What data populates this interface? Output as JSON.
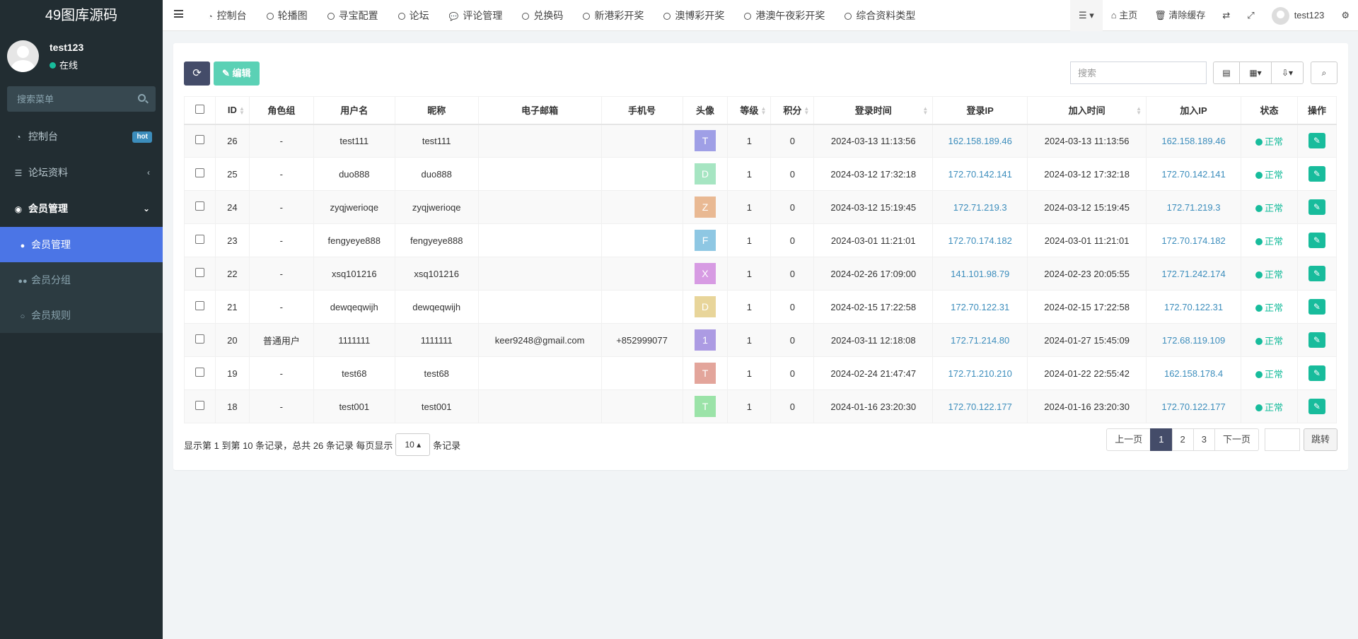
{
  "brand": "49图库源码",
  "user": {
    "name": "test123",
    "status": "在线"
  },
  "sidebar": {
    "search_placeholder": "搜索菜单",
    "items": [
      {
        "label": "控制台",
        "badge": "hot"
      },
      {
        "label": "论坛资料"
      },
      {
        "label": "会员管理"
      }
    ],
    "sub": [
      {
        "label": "会员管理"
      },
      {
        "label": "会员分组"
      },
      {
        "label": "会员规则"
      }
    ]
  },
  "tabs": [
    "控制台",
    "轮播图",
    "寻宝配置",
    "论坛",
    "评论管理",
    "兑换码",
    "新港彩开奖",
    "澳博彩开奖",
    "港澳午夜彩开奖",
    "综合资料类型"
  ],
  "topright": {
    "home": "主页",
    "clear": "清除缓存",
    "user": "test123"
  },
  "toolbar": {
    "edit": "编辑",
    "search_placeholder": "搜索"
  },
  "columns": [
    "ID",
    "角色组",
    "用户名",
    "昵称",
    "电子邮箱",
    "手机号",
    "头像",
    "等级",
    "积分",
    "登录时间",
    "登录IP",
    "加入时间",
    "加入IP",
    "状态",
    "操作"
  ],
  "rows": [
    {
      "id": "26",
      "role": "-",
      "username": "test111",
      "nickname": "test111",
      "email": "",
      "phone": "",
      "avatar": "T",
      "avatar_color": "#9f9fe6",
      "level": "1",
      "score": "0",
      "login_time": "2024-03-13 11:13:56",
      "login_ip": "162.158.189.46",
      "join_time": "2024-03-13 11:13:56",
      "join_ip": "162.158.189.46",
      "status": "正常"
    },
    {
      "id": "25",
      "role": "-",
      "username": "duo888",
      "nickname": "duo888",
      "email": "",
      "phone": "",
      "avatar": "D",
      "avatar_color": "#a6e5c2",
      "level": "1",
      "score": "0",
      "login_time": "2024-03-12 17:32:18",
      "login_ip": "172.70.142.141",
      "join_time": "2024-03-12 17:32:18",
      "join_ip": "172.70.142.141",
      "status": "正常"
    },
    {
      "id": "24",
      "role": "-",
      "username": "zyqjwerioqe",
      "nickname": "zyqjwerioqe",
      "email": "",
      "phone": "",
      "avatar": "Z",
      "avatar_color": "#e9b993",
      "level": "1",
      "score": "0",
      "login_time": "2024-03-12 15:19:45",
      "login_ip": "172.71.219.3",
      "join_time": "2024-03-12 15:19:45",
      "join_ip": "172.71.219.3",
      "status": "正常"
    },
    {
      "id": "23",
      "role": "-",
      "username": "fengyeye888",
      "nickname": "fengyeye888",
      "email": "",
      "phone": "",
      "avatar": "F",
      "avatar_color": "#8ec7e3",
      "level": "1",
      "score": "0",
      "login_time": "2024-03-01 11:21:01",
      "login_ip": "172.70.174.182",
      "join_time": "2024-03-01 11:21:01",
      "join_ip": "172.70.174.182",
      "status": "正常"
    },
    {
      "id": "22",
      "role": "-",
      "username": "xsq101216",
      "nickname": "xsq101216",
      "email": "",
      "phone": "",
      "avatar": "X",
      "avatar_color": "#d79be3",
      "level": "1",
      "score": "0",
      "login_time": "2024-02-26 17:09:00",
      "login_ip": "141.101.98.79",
      "join_time": "2024-02-23 20:05:55",
      "join_ip": "172.71.242.174",
      "status": "正常"
    },
    {
      "id": "21",
      "role": "-",
      "username": "dewqeqwijh",
      "nickname": "dewqeqwijh",
      "email": "",
      "phone": "",
      "avatar": "D",
      "avatar_color": "#e8d59a",
      "level": "1",
      "score": "0",
      "login_time": "2024-02-15 17:22:58",
      "login_ip": "172.70.122.31",
      "join_time": "2024-02-15 17:22:58",
      "join_ip": "172.70.122.31",
      "status": "正常"
    },
    {
      "id": "20",
      "role": "普通用户",
      "username": "1111111",
      "nickname": "1111111",
      "email": "keer9248@gmail.com",
      "phone": "+852999077",
      "avatar": "1",
      "avatar_color": "#ac9be3",
      "level": "1",
      "score": "0",
      "login_time": "2024-03-11 12:18:08",
      "login_ip": "172.71.214.80",
      "join_time": "2024-01-27 15:45:09",
      "join_ip": "172.68.119.109",
      "status": "正常"
    },
    {
      "id": "19",
      "role": "-",
      "username": "test68",
      "nickname": "test68",
      "email": "",
      "phone": "",
      "avatar": "T",
      "avatar_color": "#e3a59b",
      "level": "1",
      "score": "0",
      "login_time": "2024-02-24 21:47:47",
      "login_ip": "172.71.210.210",
      "join_time": "2024-01-22 22:55:42",
      "join_ip": "162.158.178.4",
      "status": "正常"
    },
    {
      "id": "18",
      "role": "-",
      "username": "test001",
      "nickname": "test001",
      "email": "",
      "phone": "",
      "avatar": "T",
      "avatar_color": "#9be3a8",
      "level": "1",
      "score": "0",
      "login_time": "2024-01-16 23:20:30",
      "login_ip": "172.70.122.177",
      "join_time": "2024-01-16 23:20:30",
      "join_ip": "172.70.122.177",
      "status": "正常"
    }
  ],
  "pager": {
    "info": "显示第 1 到第 10 条记录，总共 26 条记录 每页显示",
    "page_size": "10",
    "suffix": "条记录",
    "prev": "上一页",
    "pages": [
      "1",
      "2",
      "3"
    ],
    "next": "下一页",
    "go": "跳转"
  }
}
